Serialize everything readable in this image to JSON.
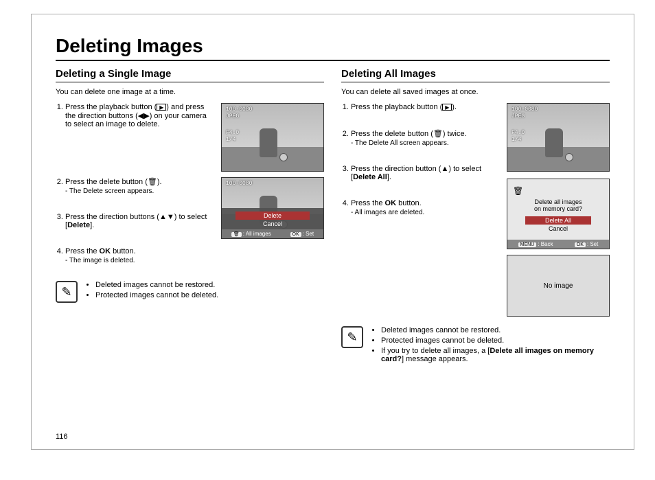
{
  "title": "Deleting Images",
  "pageNumber": "116",
  "left": {
    "subtitle": "Deleting a Single Image",
    "intro": "You can delete one image at a time.",
    "step1a": "Press the playback button (",
    "step1b": ") and press the direction buttons (◀▶) on your camera to select an image to delete.",
    "step2": "Press the delete button (",
    "step2b": ").",
    "step2sub": "- The Delete screen appears.",
    "step3a": "Press the direction buttons (▲▼) to select [",
    "step3bold": "Delete",
    "step3b": "].",
    "step4a": "Press the ",
    "step4bold": "OK",
    "step4b": " button.",
    "step4sub": "- The image is deleted.",
    "lcd": {
      "file": "100-0080",
      "format": "JPEG",
      "aperture": "F4.0",
      "count": "1/4",
      "optDelete": "Delete",
      "optCancel": "Cancel",
      "barAll": "All images",
      "barSet": "Set"
    },
    "notes": {
      "n1": "Deleted images cannot be restored.",
      "n2": "Protected images cannot be deleted."
    }
  },
  "right": {
    "subtitle": "Deleting All Images",
    "intro": "You can delete all saved images at once.",
    "step1a": "Press the playback button (",
    "step1b": ").",
    "step2a": "Press the delete button (",
    "step2b": ") twice.",
    "step2sub": "- The Delete All screen appears.",
    "step3a": "Press the direction button (▲) to select [",
    "step3bold": "Delete All",
    "step3b": "].",
    "step4a": "Press the ",
    "step4bold": "OK",
    "step4b": " button.",
    "step4sub": "- All images are deleted.",
    "lcd": {
      "file": "100-0080",
      "format": "JPEG",
      "aperture": "F4.0",
      "count": "1/4"
    },
    "dialog": {
      "line1": "Delete all images",
      "line2": "on memory card?",
      "optDeleteAll": "Delete All",
      "optCancel": "Cancel",
      "barMenu": "MENU",
      "barBack": "Back",
      "barOk": "OK",
      "barSet": "Set"
    },
    "noimage": "No image",
    "notes": {
      "n1": "Deleted images cannot be restored.",
      "n2": "Protected images cannot be deleted.",
      "n3a": "If you try to delete all images, a [",
      "n3bold": "Delete all images on memory card?",
      "n3b": "] message appears."
    }
  }
}
